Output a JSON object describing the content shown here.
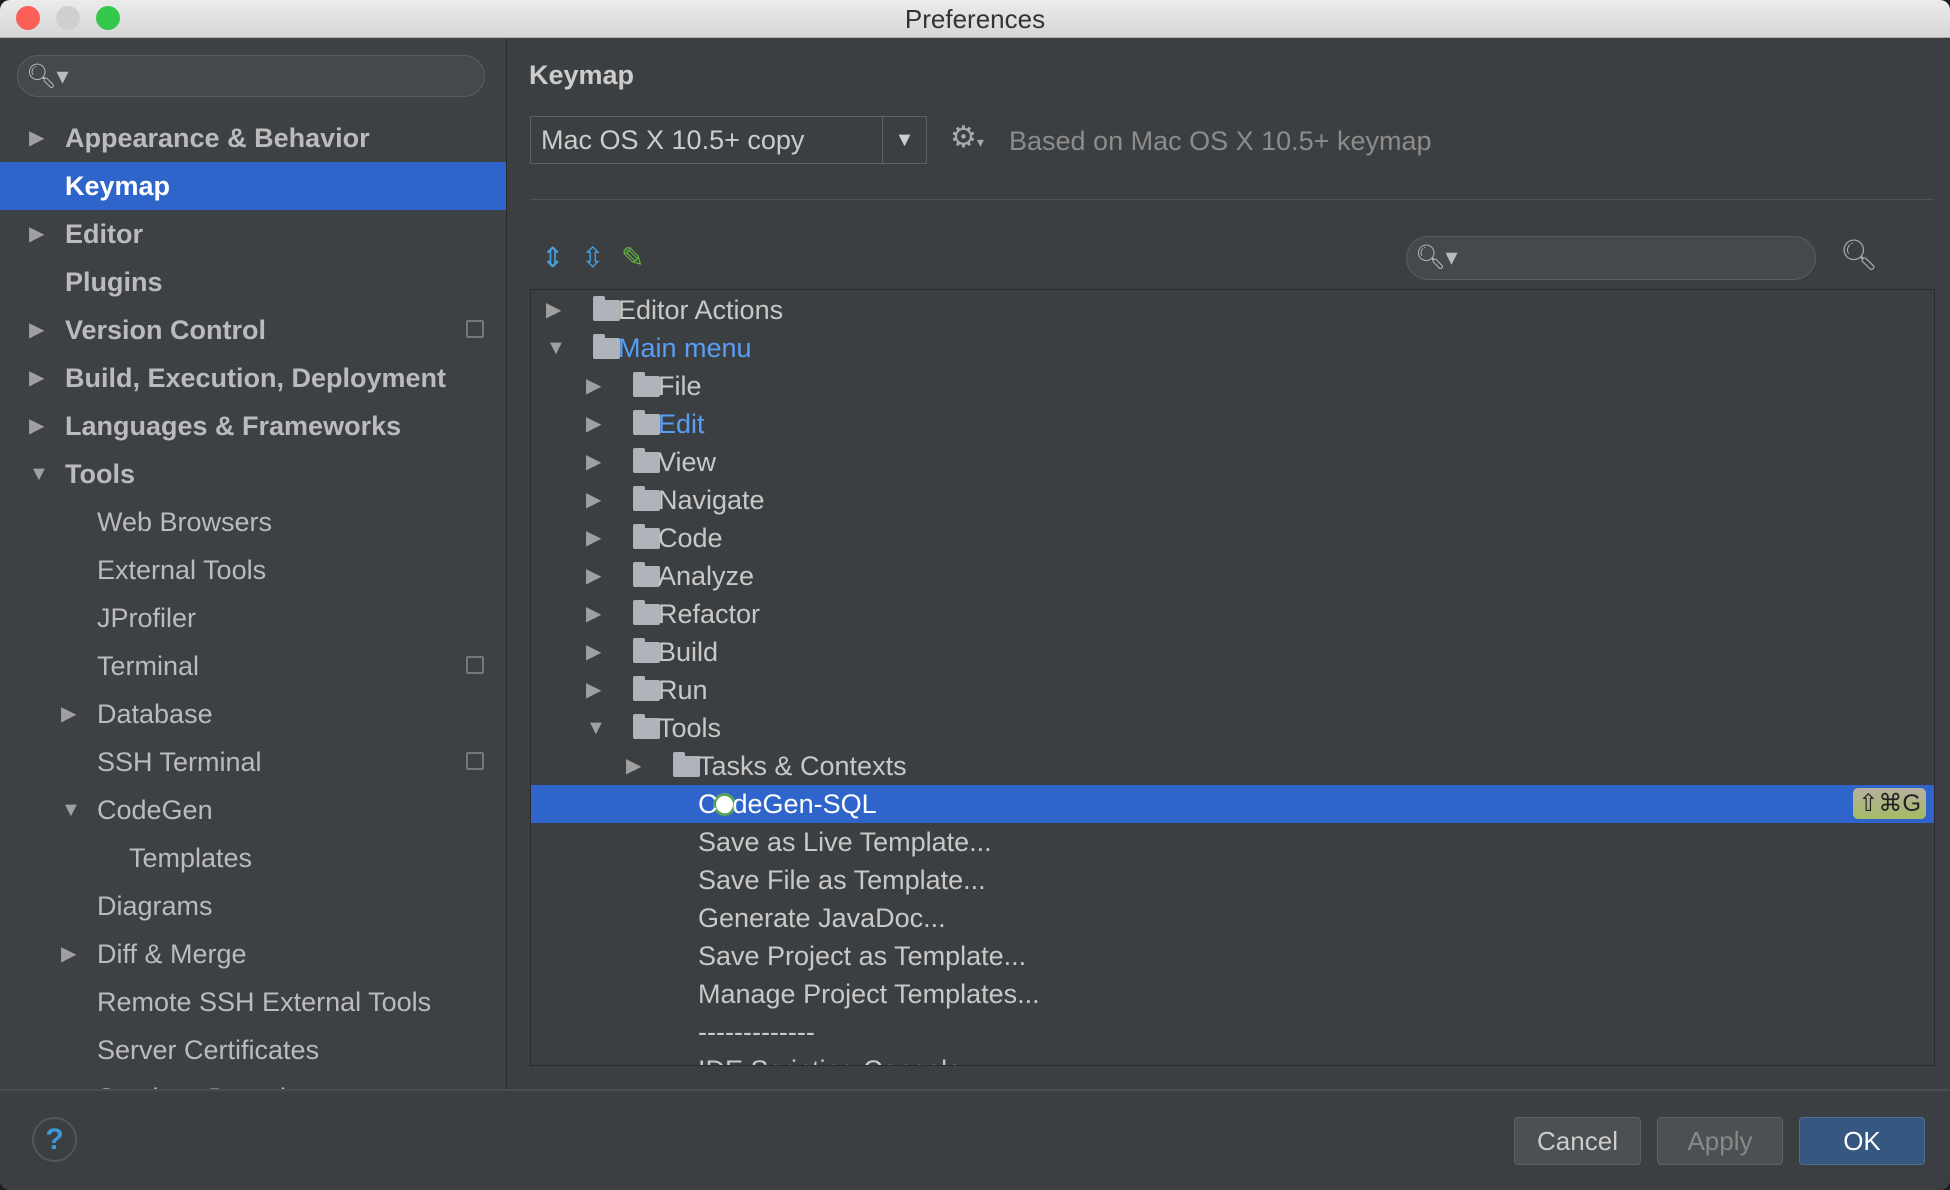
{
  "window": {
    "title": "Preferences"
  },
  "sidebar": {
    "items": [
      {
        "label": "Appearance & Behavior",
        "level": 0,
        "arrow": "right",
        "bold": true
      },
      {
        "label": "Keymap",
        "level": 0,
        "bold": true,
        "selected": true
      },
      {
        "label": "Editor",
        "level": 0,
        "arrow": "right",
        "bold": true
      },
      {
        "label": "Plugins",
        "level": 0,
        "bold": true
      },
      {
        "label": "Version Control",
        "level": 0,
        "arrow": "right",
        "bold": true,
        "copy": true
      },
      {
        "label": "Build, Execution, Deployment",
        "level": 0,
        "arrow": "right",
        "bold": true
      },
      {
        "label": "Languages & Frameworks",
        "level": 0,
        "arrow": "right",
        "bold": true
      },
      {
        "label": "Tools",
        "level": 0,
        "arrow": "down",
        "bold": true
      },
      {
        "label": "Web Browsers",
        "level": 1
      },
      {
        "label": "External Tools",
        "level": 1
      },
      {
        "label": "JProfiler",
        "level": 1
      },
      {
        "label": "Terminal",
        "level": 1,
        "copy": true
      },
      {
        "label": "Database",
        "level": 1,
        "arrow": "right"
      },
      {
        "label": "SSH Terminal",
        "level": 1,
        "copy": true
      },
      {
        "label": "CodeGen",
        "level": 1,
        "arrow": "down"
      },
      {
        "label": "Templates",
        "level": 2
      },
      {
        "label": "Diagrams",
        "level": 1
      },
      {
        "label": "Diff & Merge",
        "level": 1,
        "arrow": "right"
      },
      {
        "label": "Remote SSH External Tools",
        "level": 1
      },
      {
        "label": "Server Certificates",
        "level": 1
      },
      {
        "label": "Services Domain",
        "level": 1
      }
    ]
  },
  "keymap": {
    "heading": "Keymap",
    "scheme": "Mac OS X 10.5+ copy",
    "based_on": "Based on Mac OS X 10.5+ keymap",
    "search_placeholder": "",
    "tree": [
      {
        "label": "Editor Actions",
        "level": 0,
        "arrow": "right",
        "icon": "folder-edit-icon"
      },
      {
        "label": "Main menu",
        "level": 0,
        "arrow": "down",
        "icon": "folder-menu-icon",
        "link": true
      },
      {
        "label": "File",
        "level": 1,
        "arrow": "right",
        "icon": "folder-icon"
      },
      {
        "label": "Edit",
        "level": 1,
        "arrow": "right",
        "icon": "folder-icon",
        "link": true
      },
      {
        "label": "View",
        "level": 1,
        "arrow": "right",
        "icon": "folder-icon"
      },
      {
        "label": "Navigate",
        "level": 1,
        "arrow": "right",
        "icon": "folder-icon"
      },
      {
        "label": "Code",
        "level": 1,
        "arrow": "right",
        "icon": "folder-icon"
      },
      {
        "label": "Analyze",
        "level": 1,
        "arrow": "right",
        "icon": "folder-icon"
      },
      {
        "label": "Refactor",
        "level": 1,
        "arrow": "right",
        "icon": "folder-icon"
      },
      {
        "label": "Build",
        "level": 1,
        "arrow": "right",
        "icon": "folder-icon"
      },
      {
        "label": "Run",
        "level": 1,
        "arrow": "right",
        "icon": "folder-icon"
      },
      {
        "label": "Tools",
        "level": 1,
        "arrow": "down",
        "icon": "folder-icon"
      },
      {
        "label": "Tasks & Contexts",
        "level": 2,
        "arrow": "right",
        "icon": "folder-icon"
      },
      {
        "label": "CodeGen-SQL",
        "level": 2,
        "icon": "codegen-clock-icon",
        "selected": true,
        "shortcut": "⇧⌘G"
      },
      {
        "label": "Save as Live Template...",
        "level": 2
      },
      {
        "label": "Save File as Template...",
        "level": 2
      },
      {
        "label": "Generate JavaDoc...",
        "level": 2
      },
      {
        "label": "Save Project as Template...",
        "level": 2
      },
      {
        "label": "Manage Project Templates...",
        "level": 2
      },
      {
        "label": "-------------",
        "level": 2
      },
      {
        "label": "IDE Scripting Console",
        "level": 2
      }
    ]
  },
  "buttons": {
    "help": "?",
    "cancel": "Cancel",
    "apply": "Apply",
    "ok": "OK"
  },
  "colors": {
    "selection": "#2f65ca",
    "link": "#589df6",
    "background": "#3c3f41"
  }
}
